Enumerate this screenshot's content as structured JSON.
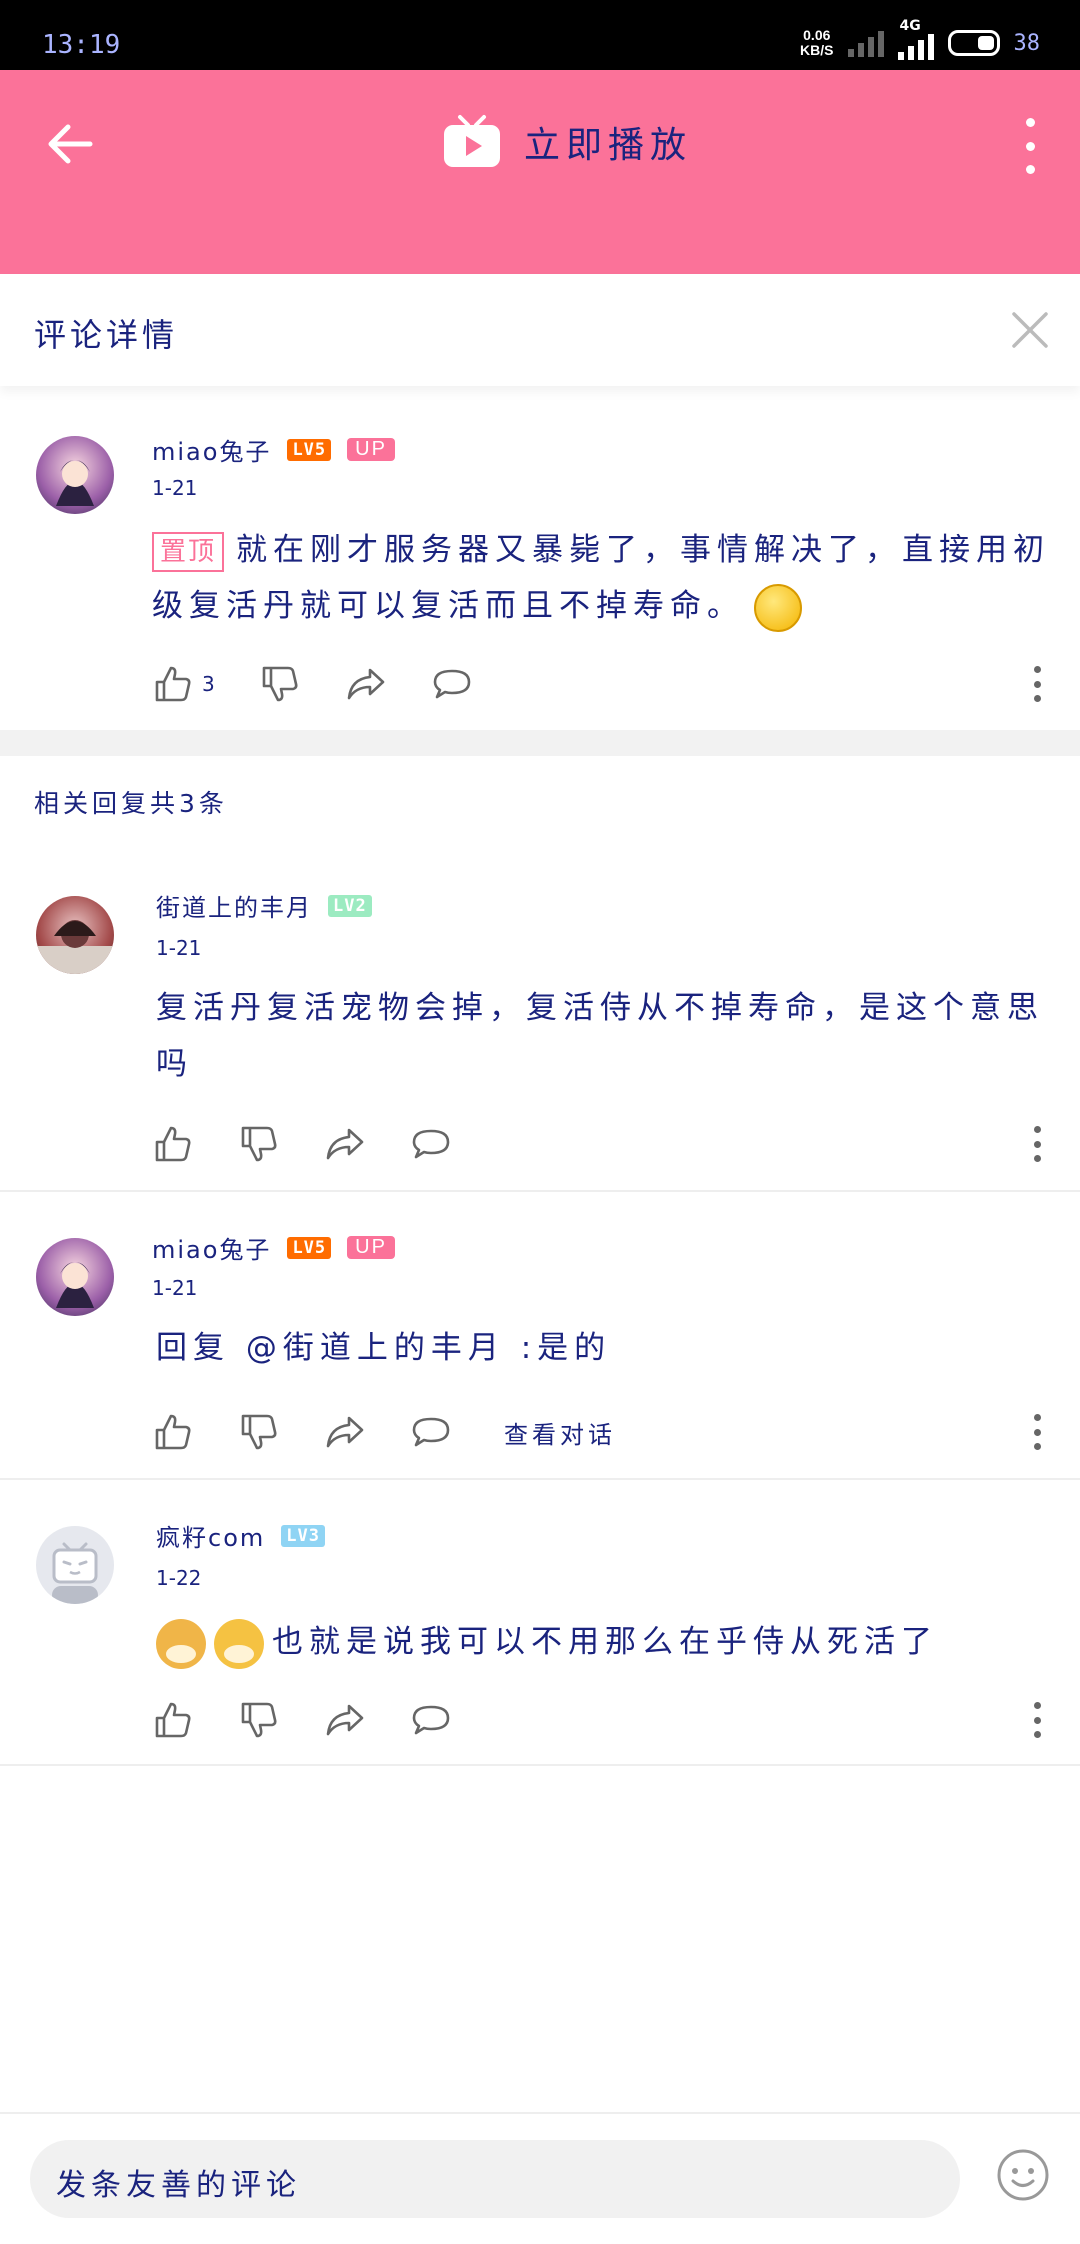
{
  "status_bar": {
    "time": "13:19",
    "speed_value": "0.06",
    "speed_unit": "KB/S",
    "network": "4G",
    "battery": "38"
  },
  "header": {
    "title": "立即播放"
  },
  "detail": {
    "title": "评论详情"
  },
  "main_comment": {
    "username": "miao兔子",
    "level": "LV5",
    "up_badge": "UP",
    "date": "1-21",
    "pin_label": "置顶",
    "text": "就在刚才服务器又暴毙了，事情解决了，直接用初级复活丹就可以复活而且不掉寿命。",
    "like_count": "3"
  },
  "replies_header": "相关回复共3条",
  "replies": [
    {
      "username": "街道上的丰月",
      "level": "LV2",
      "date": "1-21",
      "text": "复活丹复活宠物会掉，复活侍从不掉寿命，是这个意思吗"
    },
    {
      "username": "miao兔子",
      "level": "LV5",
      "up_badge": "UP",
      "date": "1-21",
      "text": "回复 @街道上的丰月 :是的",
      "view_conversation": "查看对话"
    },
    {
      "username": "疯籽com",
      "level": "LV3",
      "date": "1-22",
      "text": "也就是说我可以不用那么在乎侍从死活了"
    }
  ],
  "input": {
    "placeholder": "发条友善的评论"
  },
  "colors": {
    "brand_pink": "#fb7299",
    "text_navy": "#1a237e"
  }
}
